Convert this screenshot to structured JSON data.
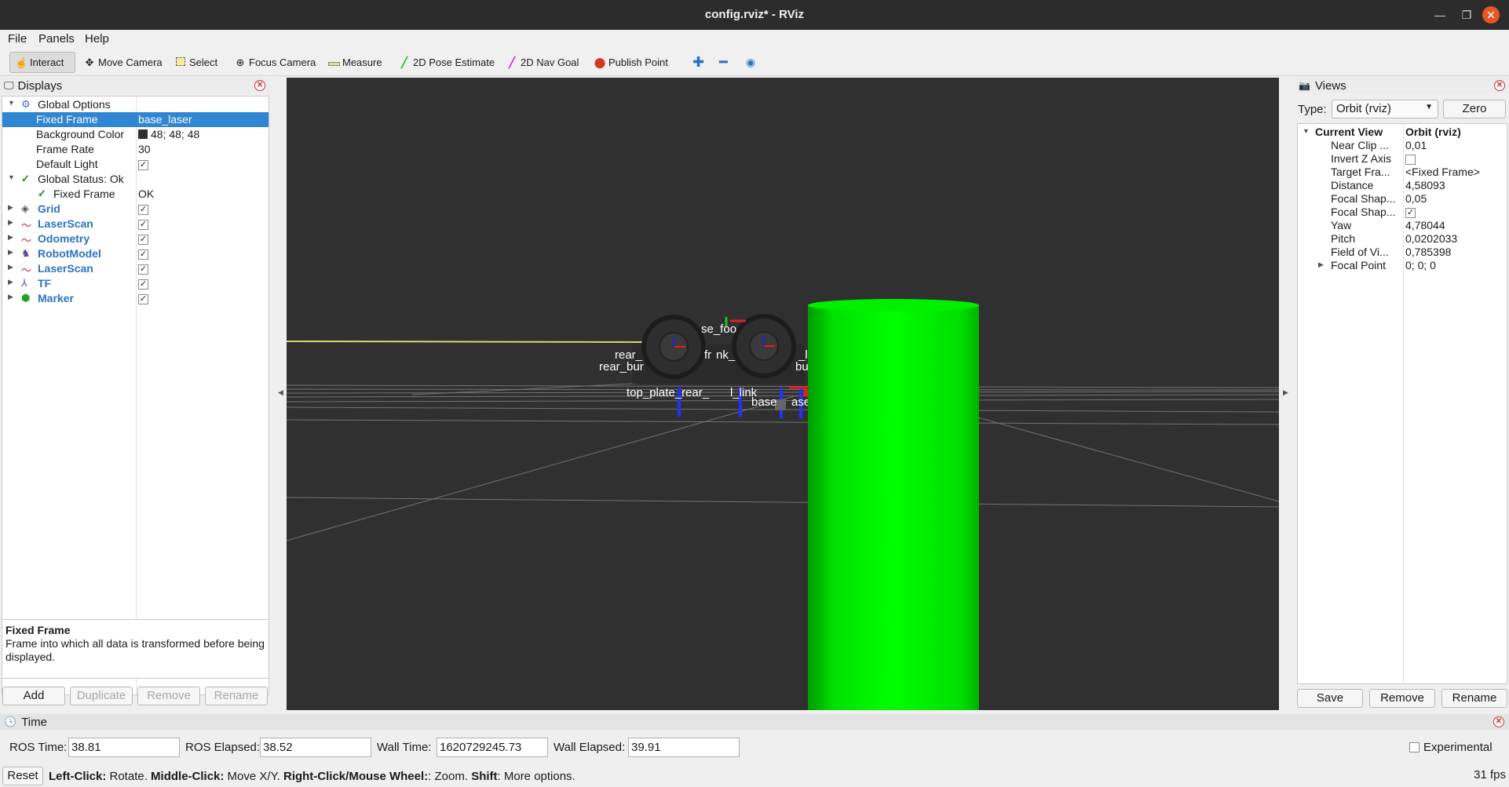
{
  "window": {
    "title": "config.rviz* - RViz"
  },
  "menu": [
    "File",
    "Panels",
    "Help"
  ],
  "toolbar": {
    "tools": [
      {
        "label": "Interact",
        "icon": "hand-icon"
      },
      {
        "label": "Move Camera",
        "icon": "move-camera-icon"
      },
      {
        "label": "Select",
        "icon": "select-icon"
      },
      {
        "label": "Focus Camera",
        "icon": "focus-camera-icon"
      },
      {
        "label": "Measure",
        "icon": "ruler-icon"
      },
      {
        "label": "2D Pose Estimate",
        "icon": "pose-estimate-icon"
      },
      {
        "label": "2D Nav Goal",
        "icon": "nav-goal-icon"
      },
      {
        "label": "Publish Point",
        "icon": "map-pin-icon"
      }
    ]
  },
  "displays": {
    "title": "Displays",
    "rows": [
      {
        "label": "Global Options",
        "value": ""
      },
      {
        "label": "Fixed Frame",
        "value": "base_laser"
      },
      {
        "label": "Background Color",
        "value": "48; 48; 48"
      },
      {
        "label": "Frame Rate",
        "value": "30"
      },
      {
        "label": "Default Light",
        "value": "✓"
      },
      {
        "label": "Global Status: Ok",
        "value": ""
      },
      {
        "label": "Fixed Frame",
        "value": "OK"
      },
      {
        "label": "Grid",
        "value": "✓"
      },
      {
        "label": "LaserScan",
        "value": "✓"
      },
      {
        "label": "Odometry",
        "value": "✓"
      },
      {
        "label": "RobotModel",
        "value": "✓"
      },
      {
        "label": "LaserScan",
        "value": "✓"
      },
      {
        "label": "TF",
        "value": "✓"
      },
      {
        "label": "Marker",
        "value": "✓"
      }
    ],
    "description_title": "Fixed Frame",
    "description_text": "Frame into which all data is transformed before being displayed.",
    "buttons": [
      "Add",
      "Duplicate",
      "Remove",
      "Rename"
    ]
  },
  "viewport": {
    "background_color": "#303030",
    "frame_labels": [
      "rear_",
      "rear_bur",
      "se_foo",
      "fr",
      "nk_",
      "_link",
      "bur",
      "top_plate_rear_",
      "l_link",
      "base",
      "ase"
    ]
  },
  "views": {
    "title": "Views",
    "type_label": "Type:",
    "type_value": "Orbit (rviz)",
    "zero_label": "Zero",
    "rows": [
      {
        "label": "Current View",
        "value": "Orbit (rviz)"
      },
      {
        "label": "Near Clip ...",
        "value": "0,01"
      },
      {
        "label": "Invert Z Axis",
        "value": ""
      },
      {
        "label": "Target Fra...",
        "value": "<Fixed Frame>"
      },
      {
        "label": "Distance",
        "value": "4,58093"
      },
      {
        "label": "Focal Shap...",
        "value": "0,05"
      },
      {
        "label": "Focal Shap...",
        "value": "✓"
      },
      {
        "label": "Yaw",
        "value": "4,78044"
      },
      {
        "label": "Pitch",
        "value": "0,0202033"
      },
      {
        "label": "Field of Vi...",
        "value": "0,785398"
      },
      {
        "label": "Focal Point",
        "value": "0; 0; 0"
      }
    ],
    "buttons": [
      "Save",
      "Remove",
      "Rename"
    ]
  },
  "time": {
    "title": "Time",
    "fields": [
      {
        "label": "ROS Time:",
        "value": "38.81"
      },
      {
        "label": "ROS Elapsed:",
        "value": "38.52"
      },
      {
        "label": "Wall Time:",
        "value": "1620729245.73"
      },
      {
        "label": "Wall Elapsed:",
        "value": "39.91"
      }
    ],
    "experimental_label": "Experimental"
  },
  "status": {
    "reset_label": "Reset",
    "hint_parts": [
      {
        "b": "Left-Click:",
        "t": " Rotate. "
      },
      {
        "b": "Middle-Click:",
        "t": " Move X/Y. "
      },
      {
        "b": "Right-Click/Mouse Wheel:",
        "t": ": Zoom. "
      },
      {
        "b": "Shift",
        "t": ": More options."
      }
    ],
    "fps": "31 fps"
  },
  "colors": {
    "accent": "#2f86d2",
    "cylinder": "#00ff00",
    "close": "#e95420"
  }
}
